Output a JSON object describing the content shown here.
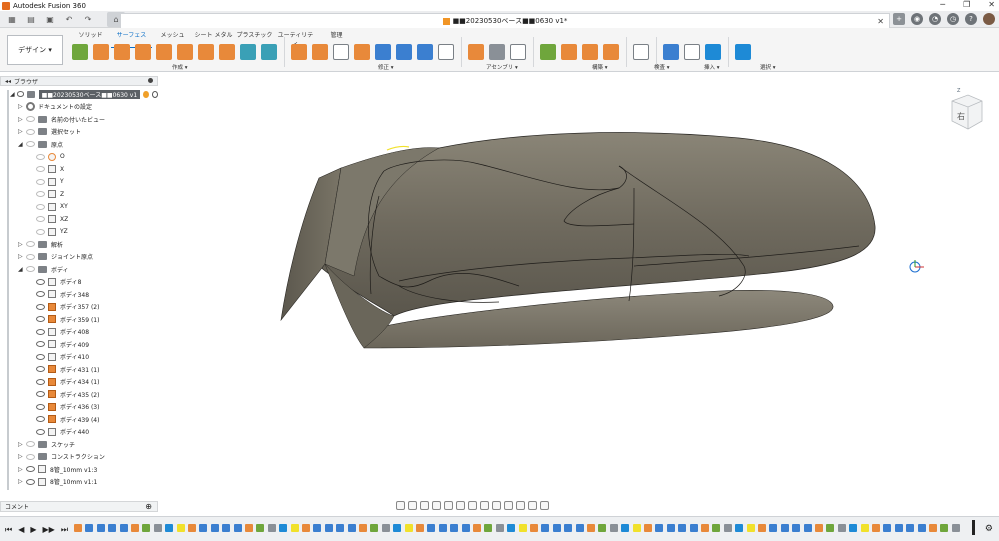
{
  "titlebar": {
    "app_title": "Autodesk Fusion 360",
    "minimize": "─",
    "maximize": "❐",
    "close": "✕"
  },
  "document": {
    "tab_title": "■■20230530ベース■■0630 v1*",
    "close": "✕"
  },
  "ribbon": {
    "workspace_label": "デザイン ▾",
    "tabs": [
      "ソリッド",
      "サーフェス",
      "メッシュ",
      "シート メタル",
      "プラスチック",
      "ユーティリティ",
      "管理"
    ],
    "active_tab": "サーフェス",
    "groups": {
      "create": "作成 ▾",
      "modify": "修正 ▾",
      "assemble": "アセンブリ ▾",
      "construct": "構築 ▾",
      "inspect": "検査 ▾",
      "insert": "挿入 ▾",
      "select": "選択 ▾"
    }
  },
  "browser": {
    "header": "ブラウザ",
    "root": "■■20230530ベース■■0630 v1",
    "items": [
      {
        "label": "ドキュメントの設定",
        "level": 1,
        "type": "gear",
        "expand": "▷"
      },
      {
        "label": "名前の付いたビュー",
        "level": 1,
        "type": "folder",
        "expand": "▷"
      },
      {
        "label": "選択セット",
        "level": 1,
        "type": "folder",
        "expand": "▷"
      },
      {
        "label": "原点",
        "level": 1,
        "type": "folder",
        "expand": "◢"
      },
      {
        "label": "O",
        "level": 2,
        "type": "point"
      },
      {
        "label": "X",
        "level": 2,
        "type": "axis"
      },
      {
        "label": "Y",
        "level": 2,
        "type": "axis"
      },
      {
        "label": "Z",
        "level": 2,
        "type": "axis"
      },
      {
        "label": "XY",
        "level": 2,
        "type": "plane"
      },
      {
        "label": "XZ",
        "level": 2,
        "type": "plane"
      },
      {
        "label": "YZ",
        "level": 2,
        "type": "plane"
      },
      {
        "label": "解析",
        "level": 1,
        "type": "folder",
        "expand": "▷"
      },
      {
        "label": "ジョイント原点",
        "level": 1,
        "type": "folder",
        "expand": "▷"
      },
      {
        "label": "ボディ",
        "level": 1,
        "type": "folder",
        "expand": "◢"
      },
      {
        "label": "ボディ8",
        "level": 2,
        "type": "body"
      },
      {
        "label": "ボディ348",
        "level": 2,
        "type": "body"
      },
      {
        "label": "ボディ357 (2)",
        "level": 2,
        "type": "body-o"
      },
      {
        "label": "ボディ359 (1)",
        "level": 2,
        "type": "body-o"
      },
      {
        "label": "ボディ408",
        "level": 2,
        "type": "body"
      },
      {
        "label": "ボディ409",
        "level": 2,
        "type": "body"
      },
      {
        "label": "ボディ410",
        "level": 2,
        "type": "body"
      },
      {
        "label": "ボディ431 (1)",
        "level": 2,
        "type": "body-o"
      },
      {
        "label": "ボディ434 (1)",
        "level": 2,
        "type": "body-o"
      },
      {
        "label": "ボディ435 (2)",
        "level": 2,
        "type": "body-o"
      },
      {
        "label": "ボディ436 (3)",
        "level": 2,
        "type": "body-o"
      },
      {
        "label": "ボディ439 (4)",
        "level": 2,
        "type": "body-o"
      },
      {
        "label": "ボディ440",
        "level": 2,
        "type": "body"
      },
      {
        "label": "スケッチ",
        "level": 1,
        "type": "folder",
        "expand": "▷"
      },
      {
        "label": "コンストラクション",
        "level": 1,
        "type": "folder",
        "expand": "▷"
      },
      {
        "label": "8管_10mm v1:3",
        "level": 1,
        "type": "link",
        "expand": "▷"
      },
      {
        "label": "8管_10mm v1:1",
        "level": 1,
        "type": "link",
        "expand": "▷"
      }
    ]
  },
  "comment_panel": {
    "label": "コメント",
    "add": "⊕"
  },
  "viewcube": {
    "face_label": "右",
    "axis_label": "Z"
  },
  "timeline": {
    "controls": [
      "⏮",
      "◀",
      "▶",
      "▶▶",
      "⏭"
    ],
    "settings": "⚙"
  },
  "colors": {
    "accent": "#0b6fc7",
    "model_surface": "#6f6a5e",
    "model_edge": "#2a2824",
    "highlight_yellow": "#f1e12b"
  }
}
